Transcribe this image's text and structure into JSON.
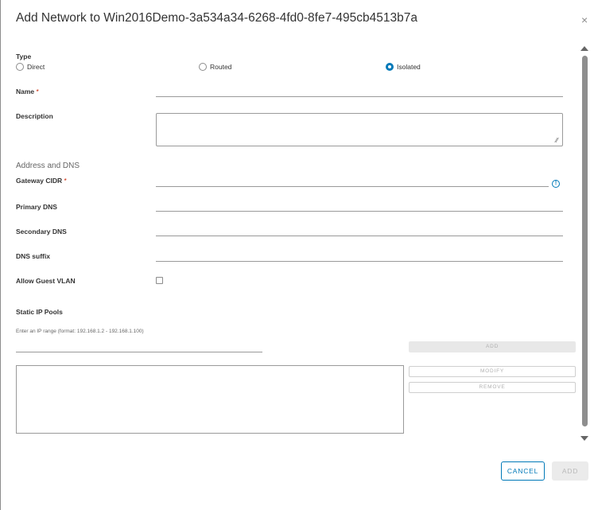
{
  "dialog": {
    "title": "Add Network to Win2016Demo-3a534a34-6268-4fd0-8fe7-495cb4513b7a",
    "close_symbol": "×"
  },
  "type": {
    "label": "Type",
    "options": [
      {
        "label": "Direct",
        "selected": false
      },
      {
        "label": "Routed",
        "selected": false
      },
      {
        "label": "Isolated",
        "selected": true
      }
    ]
  },
  "name": {
    "label": "Name",
    "required_mark": "*",
    "value": ""
  },
  "description": {
    "label": "Description",
    "value": ""
  },
  "address_dns": {
    "section_title": "Address and DNS",
    "gateway_cidr": {
      "label": "Gateway CIDR",
      "required_mark": "*",
      "value": "",
      "info_icon": "info-icon"
    },
    "primary_dns": {
      "label": "Primary DNS",
      "value": ""
    },
    "secondary_dns": {
      "label": "Secondary DNS",
      "value": ""
    },
    "dns_suffix": {
      "label": "DNS suffix",
      "value": ""
    }
  },
  "guest_vlan": {
    "label": "Allow Guest VLAN",
    "checked": false
  },
  "static_ip_pools": {
    "label": "Static IP Pools",
    "hint": "Enter an IP range (format: 192.168.1.2 - 192.168.1.100)",
    "input_value": "",
    "add_label": "ADD",
    "modify_label": "MODIFY",
    "remove_label": "REMOVE",
    "items": []
  },
  "footer": {
    "cancel_label": "CANCEL",
    "add_label": "ADD"
  },
  "colors": {
    "accent": "#0079b8",
    "required": "#c92100",
    "disabled_text": "#b0b0b0"
  }
}
